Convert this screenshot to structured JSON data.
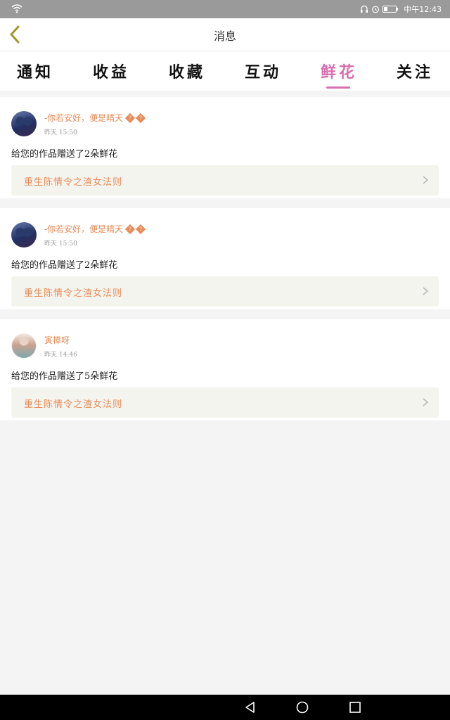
{
  "status_bar": {
    "time": "中午12:43",
    "icons": [
      "wifi-icon",
      "headset-icon",
      "alarm-icon",
      "battery-icon"
    ]
  },
  "header": {
    "title": "消息",
    "back_icon": "chevron-left-icon"
  },
  "tabs": [
    {
      "label": "通知",
      "active": false
    },
    {
      "label": "收益",
      "active": false
    },
    {
      "label": "收藏",
      "active": false
    },
    {
      "label": "互动",
      "active": false
    },
    {
      "label": "鲜花",
      "active": true
    },
    {
      "label": "关注",
      "active": false
    }
  ],
  "colors": {
    "accent_pink": "#d86fae",
    "accent_orange": "#e98b57",
    "status_bar": "#9a9a9a"
  },
  "messages": [
    {
      "username": "-你若安好，便是晴天",
      "badges": [
        "?",
        "?"
      ],
      "time": "昨天 15:50",
      "text": "给您的作品赠送了2朵鲜花",
      "work_title": "重生陈情令之渣女法则"
    },
    {
      "username": "-你若安好，便是晴天",
      "badges": [
        "?",
        "?"
      ],
      "time": "昨天 15:50",
      "text": "给您的作品赠送了2朵鲜花",
      "work_title": "重生陈情令之渣女法则"
    },
    {
      "username": "寅樟呀",
      "badges": [],
      "time": "昨天 14:46",
      "text": "给您的作品赠送了5朵鲜花",
      "work_title": "重生陈情令之渣女法则"
    }
  ],
  "nav_bar": {
    "icons": [
      "back-triangle-icon",
      "home-circle-icon",
      "recents-square-icon"
    ]
  }
}
